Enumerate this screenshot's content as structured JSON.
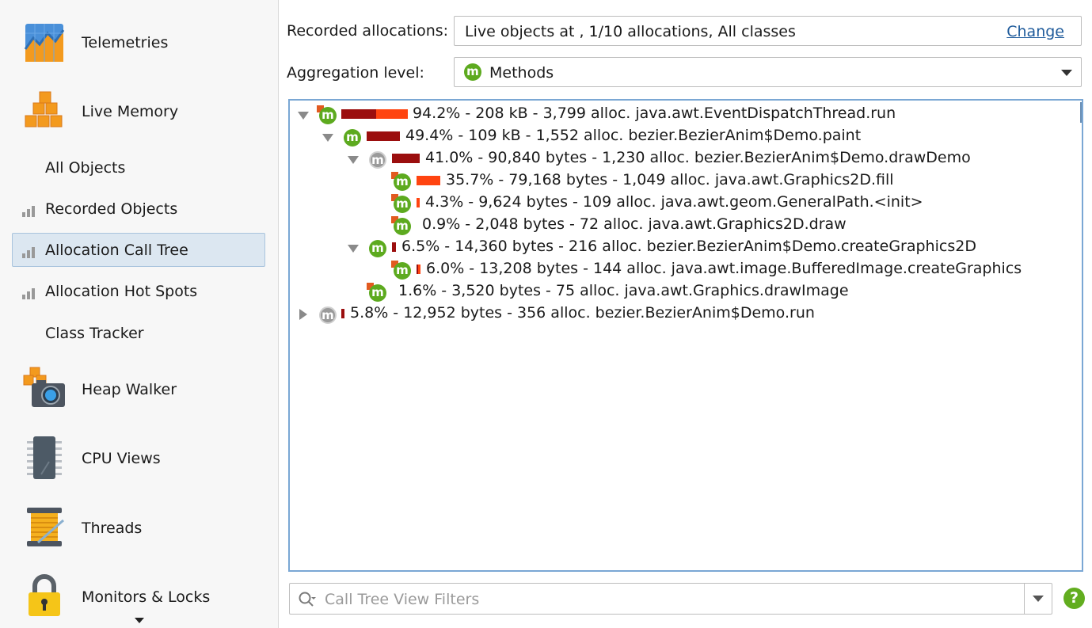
{
  "sidebar": {
    "items": [
      {
        "label": "Telemetries",
        "icon": "telemetries-icon"
      },
      {
        "label": "Live Memory",
        "icon": "live-memory-icon"
      },
      {
        "label": "All Objects"
      },
      {
        "label": "Recorded Objects",
        "icon": "bar-chart-icon"
      },
      {
        "label": "Allocation Call Tree",
        "icon": "bar-chart-icon",
        "selected": true
      },
      {
        "label": "Allocation Hot Spots",
        "icon": "bar-chart-icon"
      },
      {
        "label": "Class Tracker"
      },
      {
        "label": "Heap Walker",
        "icon": "heap-walker-camera-icon"
      },
      {
        "label": "CPU Views",
        "icon": "cpu-chip-icon"
      },
      {
        "label": "Threads",
        "icon": "thread-spool-icon"
      },
      {
        "label": "Monitors & Locks",
        "icon": "padlock-icon"
      }
    ]
  },
  "header": {
    "recorded_label": "Recorded allocations:",
    "recorded_value": "Live objects at  , 1/10 allocations, All classes",
    "change_link": "Change",
    "aggregation_label": "Aggregation level:",
    "aggregation_value": "Methods",
    "aggregation_icon_letter": "m"
  },
  "tree": {
    "rows": [
      {
        "text": "94.2% - 208 kB - 3,799 alloc. java.awt.EventDispatchThread.run",
        "toggle": "open",
        "icon": "green",
        "flag": true
      },
      {
        "text": "49.4% - 109 kB - 1,552 alloc. bezier.BezierAnim$Demo.paint",
        "toggle": "open",
        "icon": "green",
        "flag": false
      },
      {
        "text": "41.0% - 90,840 bytes - 1,230 alloc. bezier.BezierAnim$Demo.drawDemo",
        "toggle": "open",
        "icon": "gray",
        "flag": false
      },
      {
        "text": "35.7% - 79,168 bytes - 1,049 alloc. java.awt.Graphics2D.fill",
        "toggle": "none",
        "icon": "green",
        "flag": true
      },
      {
        "text": "4.3% - 9,624 bytes - 109 alloc. java.awt.geom.GeneralPath.<init>",
        "toggle": "none",
        "icon": "green",
        "flag": true
      },
      {
        "text": "0.9% - 2,048 bytes - 72 alloc. java.awt.Graphics2D.draw",
        "toggle": "none",
        "icon": "green",
        "flag": true
      },
      {
        "text": "6.5% - 14,360 bytes - 216 alloc. bezier.BezierAnim$Demo.createGraphics2D",
        "toggle": "open",
        "icon": "green",
        "flag": false
      },
      {
        "text": "6.0% - 13,208 bytes - 144 alloc. java.awt.image.BufferedImage.createGraphics",
        "toggle": "none",
        "icon": "green",
        "flag": true
      },
      {
        "text": "1.6% - 3,520 bytes - 75 alloc. java.awt.Graphics.drawImage",
        "toggle": "none",
        "icon": "green",
        "flag": true
      },
      {
        "text": "5.8% - 12,952 bytes - 356 alloc. bezier.BezierAnim$Demo.run",
        "toggle": "closed",
        "icon": "gray",
        "flag": false
      }
    ]
  },
  "filter": {
    "placeholder": "Call Tree View Filters",
    "help_label": "?"
  },
  "colors": {
    "bar_dark": "#9b0e0e",
    "bar_orange": "#ff4410",
    "method_green": "#5daa1f",
    "selection_bg": "#dce7f1",
    "tree_border": "#7aa7d4",
    "link": "#1f5b9b"
  }
}
